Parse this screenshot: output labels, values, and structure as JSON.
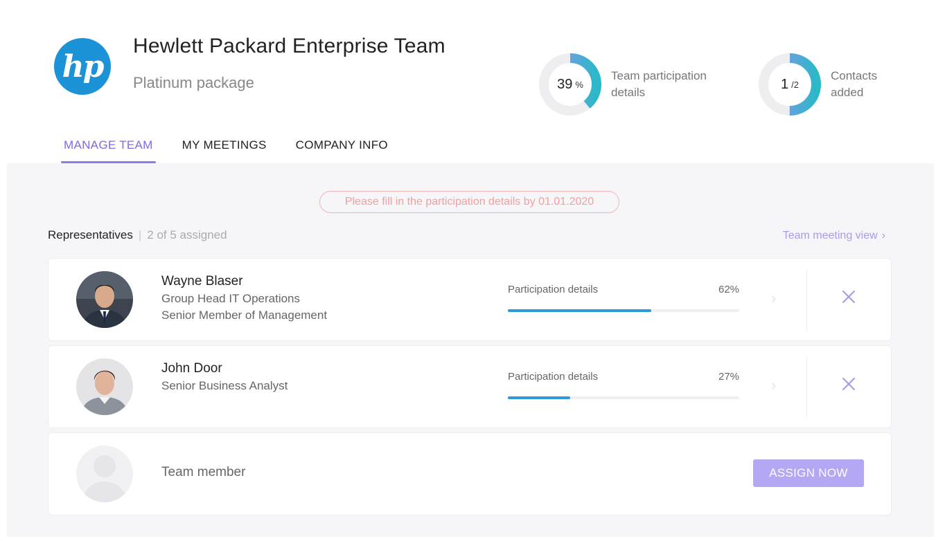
{
  "header": {
    "logo_text": "hp",
    "title": "Hewlett Packard Enterprise Team",
    "subtitle": "Platinum package",
    "stats": [
      {
        "value": "39",
        "unit": "%",
        "label_line1": "Team participation",
        "label_line2": "details",
        "fraction": 0.39
      },
      {
        "value": "1",
        "unit": "/2",
        "label_line1": "Contacts",
        "label_line2": "added",
        "fraction": 0.5
      }
    ],
    "tabs": [
      {
        "label": "MANAGE TEAM",
        "active": true
      },
      {
        "label": "MY MEETINGS",
        "active": false
      },
      {
        "label": "COMPANY INFO",
        "active": false
      }
    ]
  },
  "notice": "Please fill in the participation details by 01.01.2020",
  "representatives": {
    "heading": "Representatives",
    "separator": "|",
    "count": "2 of 5 assigned",
    "team_view_link": "Team meeting view",
    "rows": [
      {
        "name": "Wayne Blaser",
        "role1": "Group Head IT Operations",
        "role2": "Senior Member of Management",
        "progress_label": "Participation details",
        "progress_text": "62%",
        "progress": 0.62
      },
      {
        "name": "John Door",
        "role1": "Senior Business Analyst",
        "role2": "",
        "progress_label": "Participation details",
        "progress_text": "27%",
        "progress": 0.27
      }
    ],
    "empty_slot": {
      "label": "Team member",
      "button": "ASSIGN NOW"
    }
  },
  "colors": {
    "accent": "#7b6ee0",
    "progress": "#2b9ad6",
    "ring_gradient_start": "#9b8ef0",
    "ring_gradient_end": "#2bb8c8",
    "notice": "#f0a0a0",
    "button": "#b4a8f5"
  }
}
